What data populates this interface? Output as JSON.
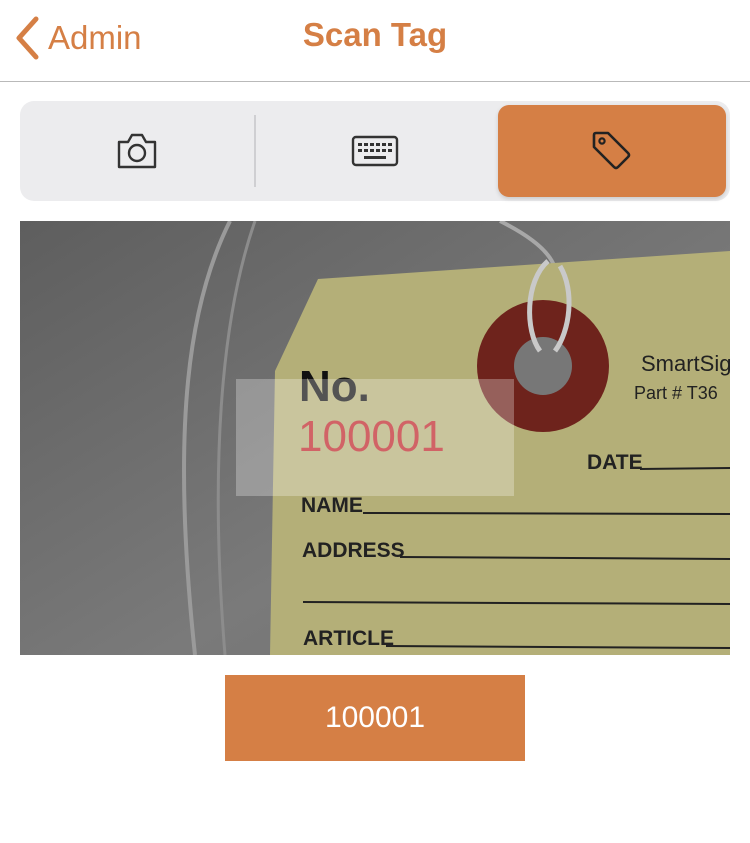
{
  "nav": {
    "back_label": "Admin",
    "title": "Scan Tag"
  },
  "segments": [
    {
      "icon": "camera-icon",
      "selected": false
    },
    {
      "icon": "keyboard-icon",
      "selected": false
    },
    {
      "icon": "tag-icon",
      "selected": true
    }
  ],
  "preview": {
    "tag_no_label": "No.",
    "tag_number": "100001",
    "brand": "SmartSig",
    "part": "Part # T36",
    "date_label": "DATE",
    "name_label": "NAME",
    "address_label": "ADDRESS",
    "article_label": "ARTICLE"
  },
  "result": {
    "value": "100001"
  },
  "colors": {
    "accent": "#d57f45",
    "tag_number": "#c0282c"
  }
}
